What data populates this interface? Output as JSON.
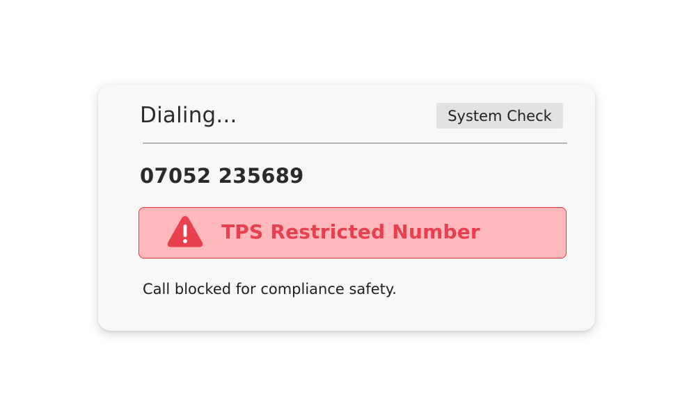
{
  "dialer": {
    "status": "Dialing...",
    "system_check_label": "System Check",
    "phone_number": "07052 235689",
    "alert": {
      "icon": "warning-triangle-icon",
      "text": "TPS Restricted Number",
      "color": "#e8404c",
      "background": "#ffb8bb"
    },
    "note": "Call blocked for compliance safety."
  }
}
